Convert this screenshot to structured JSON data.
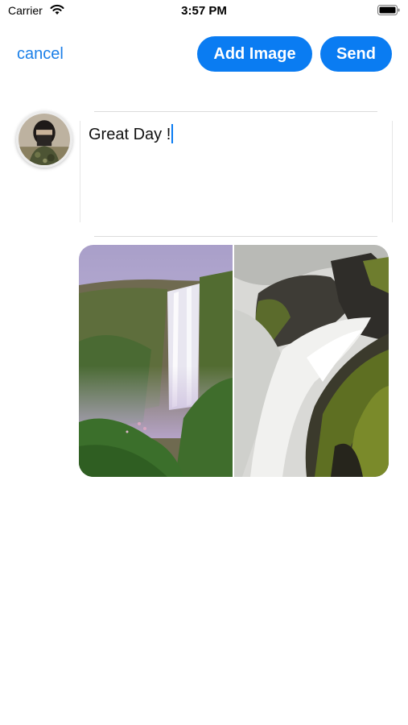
{
  "status_bar": {
    "carrier": "Carrier",
    "time": "3:57 PM"
  },
  "nav": {
    "cancel_label": "cancel",
    "add_image_label": "Add Image",
    "send_label": "Send"
  },
  "compose": {
    "text": "Great Day !"
  },
  "icons": {
    "wifi": "wifi-icon",
    "battery": "battery-icon",
    "avatar": "user-avatar"
  },
  "colors": {
    "accent": "#0a7cf2",
    "cancel_text": "#1a7fe8"
  },
  "attachments": [
    "waterfall-cliff-photo",
    "waterfall-rocks-photo"
  ]
}
